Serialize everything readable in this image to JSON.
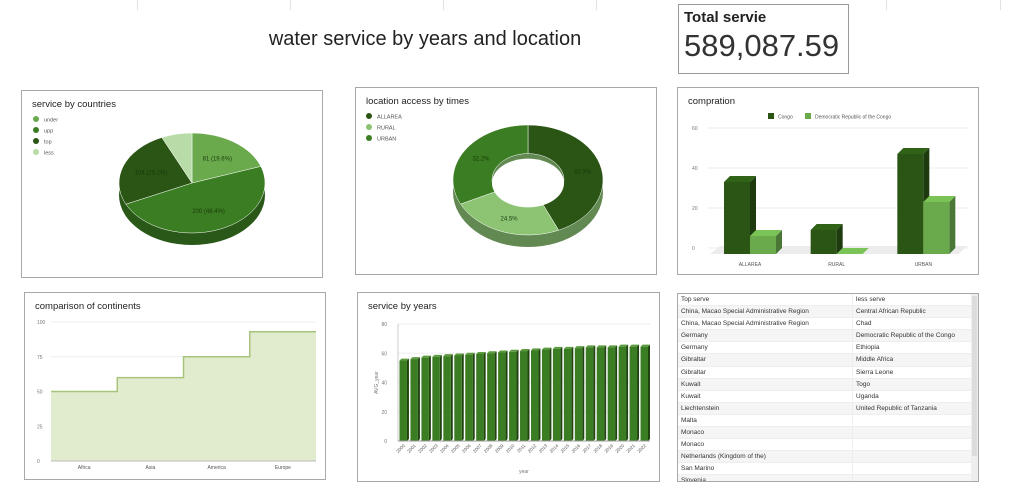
{
  "header": {
    "title": "water service by years and location"
  },
  "total": {
    "label": "Total servie",
    "value": "589,087.59"
  },
  "colors": {
    "dark": "#2a5515",
    "mid": "#3b7d22",
    "light": "#6aaa4c",
    "pale": "#b8dca8",
    "area": "#e1ebcd",
    "areaLine": "#a8c47c"
  },
  "chart_data": [
    {
      "type": "pie",
      "title": "service by countries",
      "legend_position": "top-left",
      "slices": [
        {
          "name": "under",
          "value": 81,
          "label": "81 (19.6%)",
          "color": "#6aaa4c"
        },
        {
          "name": "upp",
          "value": 200,
          "label": "200 (48.4%)",
          "color": "#3b7d22"
        },
        {
          "name": "top",
          "value": 104,
          "label": "104 (25.2%)",
          "color": "#2a5515"
        },
        {
          "name": "less",
          "value": 28,
          "label": "",
          "color": "#b8dca8"
        }
      ]
    },
    {
      "type": "pie",
      "subtype": "donut",
      "title": "location access by times",
      "legend_position": "top-left",
      "slices": [
        {
          "name": "ALLAREA",
          "value": 43.3,
          "label": "43.3%",
          "color": "#2a5515"
        },
        {
          "name": "RURAL",
          "value": 24.5,
          "label": "24.5%",
          "color": "#8cc474"
        },
        {
          "name": "URBAN",
          "value": 32.2,
          "label": "32.2%",
          "color": "#3b7d22"
        }
      ]
    },
    {
      "type": "bar",
      "title": "compration",
      "legend_position": "top",
      "categories": [
        "ALLAREA",
        "RURAL",
        "URBAN"
      ],
      "ylim": [
        0,
        60
      ],
      "yticks": [
        0,
        20,
        40,
        60
      ],
      "series": [
        {
          "name": "Congo",
          "values": [
            36,
            12,
            50
          ],
          "color": "#2a5515"
        },
        {
          "name": "Democratic Republic of the Congo",
          "values": [
            9,
            0,
            26
          ],
          "color": "#6aaa4c"
        }
      ]
    },
    {
      "type": "area",
      "subtype": "stepped",
      "title": "comparison of continents",
      "categories": [
        "Africa",
        "Asia",
        "America",
        "Europe"
      ],
      "values": [
        50,
        60,
        75,
        93
      ],
      "ylim": [
        0,
        100
      ],
      "yticks": [
        0,
        25,
        50,
        75,
        100
      ]
    },
    {
      "type": "bar",
      "title": "service by years",
      "xlabel": "year",
      "ylabel": "AVG_year",
      "ylim": [
        0,
        80
      ],
      "yticks": [
        0,
        20,
        40,
        60,
        80
      ],
      "categories": [
        "2000",
        "2001",
        "2002",
        "2003",
        "2004",
        "2005",
        "2006",
        "2007",
        "2008",
        "2009",
        "2010",
        "2011",
        "2012",
        "2013",
        "2014",
        "2015",
        "2016",
        "2017",
        "2018",
        "2019",
        "2020",
        "2021",
        "2022"
      ],
      "values": [
        55,
        56,
        57,
        57.5,
        58,
        58.5,
        59,
        59.5,
        60,
        60.5,
        61,
        61.5,
        62,
        62.5,
        63,
        63,
        63.5,
        64,
        64,
        64,
        64.5,
        64.5,
        64.5
      ]
    },
    {
      "type": "table",
      "columns": [
        "Top serve",
        "less serve"
      ],
      "rows": [
        [
          "China, Macao Special Administrative Region",
          "Central African Republic"
        ],
        [
          "China, Macao Special Administrative Region",
          "Chad"
        ],
        [
          "Germany",
          "Democratic Republic of the Congo"
        ],
        [
          "Germany",
          "Ethiopia"
        ],
        [
          "Gibraltar",
          "Middle Africa"
        ],
        [
          "Gibraltar",
          "Sierra Leone"
        ],
        [
          "Kuwait",
          "Togo"
        ],
        [
          "Kuwait",
          "Uganda"
        ],
        [
          "Liechtenstein",
          "United Republic of Tanzania"
        ],
        [
          "Malta",
          ""
        ],
        [
          "Monaco",
          ""
        ],
        [
          "Monaco",
          ""
        ],
        [
          "Netherlands (Kingdom of the)",
          ""
        ],
        [
          "San Marino",
          ""
        ],
        [
          "Slovenia",
          ""
        ]
      ]
    }
  ]
}
